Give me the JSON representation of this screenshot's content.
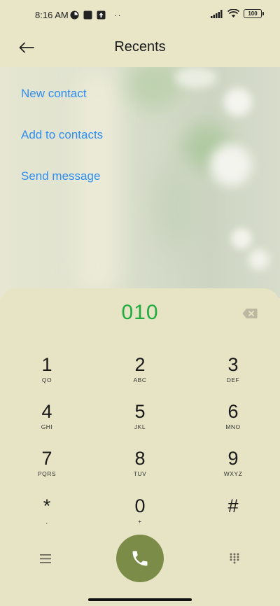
{
  "status_bar": {
    "time": "8:16 AM",
    "more": "··",
    "battery": "100"
  },
  "header": {
    "title": "Recents"
  },
  "actions": [
    "New contact",
    "Add to contacts",
    "Send message"
  ],
  "dialer": {
    "number": "010",
    "keys": [
      {
        "digit": "1",
        "letters": "QO"
      },
      {
        "digit": "2",
        "letters": "ABC"
      },
      {
        "digit": "3",
        "letters": "DEF"
      },
      {
        "digit": "4",
        "letters": "GHI"
      },
      {
        "digit": "5",
        "letters": "JKL"
      },
      {
        "digit": "6",
        "letters": "MNO"
      },
      {
        "digit": "7",
        "letters": "PQRS"
      },
      {
        "digit": "8",
        "letters": "TUV"
      },
      {
        "digit": "9",
        "letters": "WXYZ"
      },
      {
        "digit": "*",
        "letters": ","
      },
      {
        "digit": "0",
        "letters": "+"
      },
      {
        "digit": "#",
        "letters": ""
      }
    ]
  },
  "colors": {
    "accent_link": "#2f8ef2",
    "number": "#1fab3f",
    "call_button": "#7a8c48",
    "background": "#e9e6c8"
  },
  "icons": {
    "back": "back-arrow-icon",
    "backspace": "backspace-icon",
    "menu": "menu-icon",
    "call": "phone-icon",
    "dialpad": "dialpad-grid-icon"
  }
}
